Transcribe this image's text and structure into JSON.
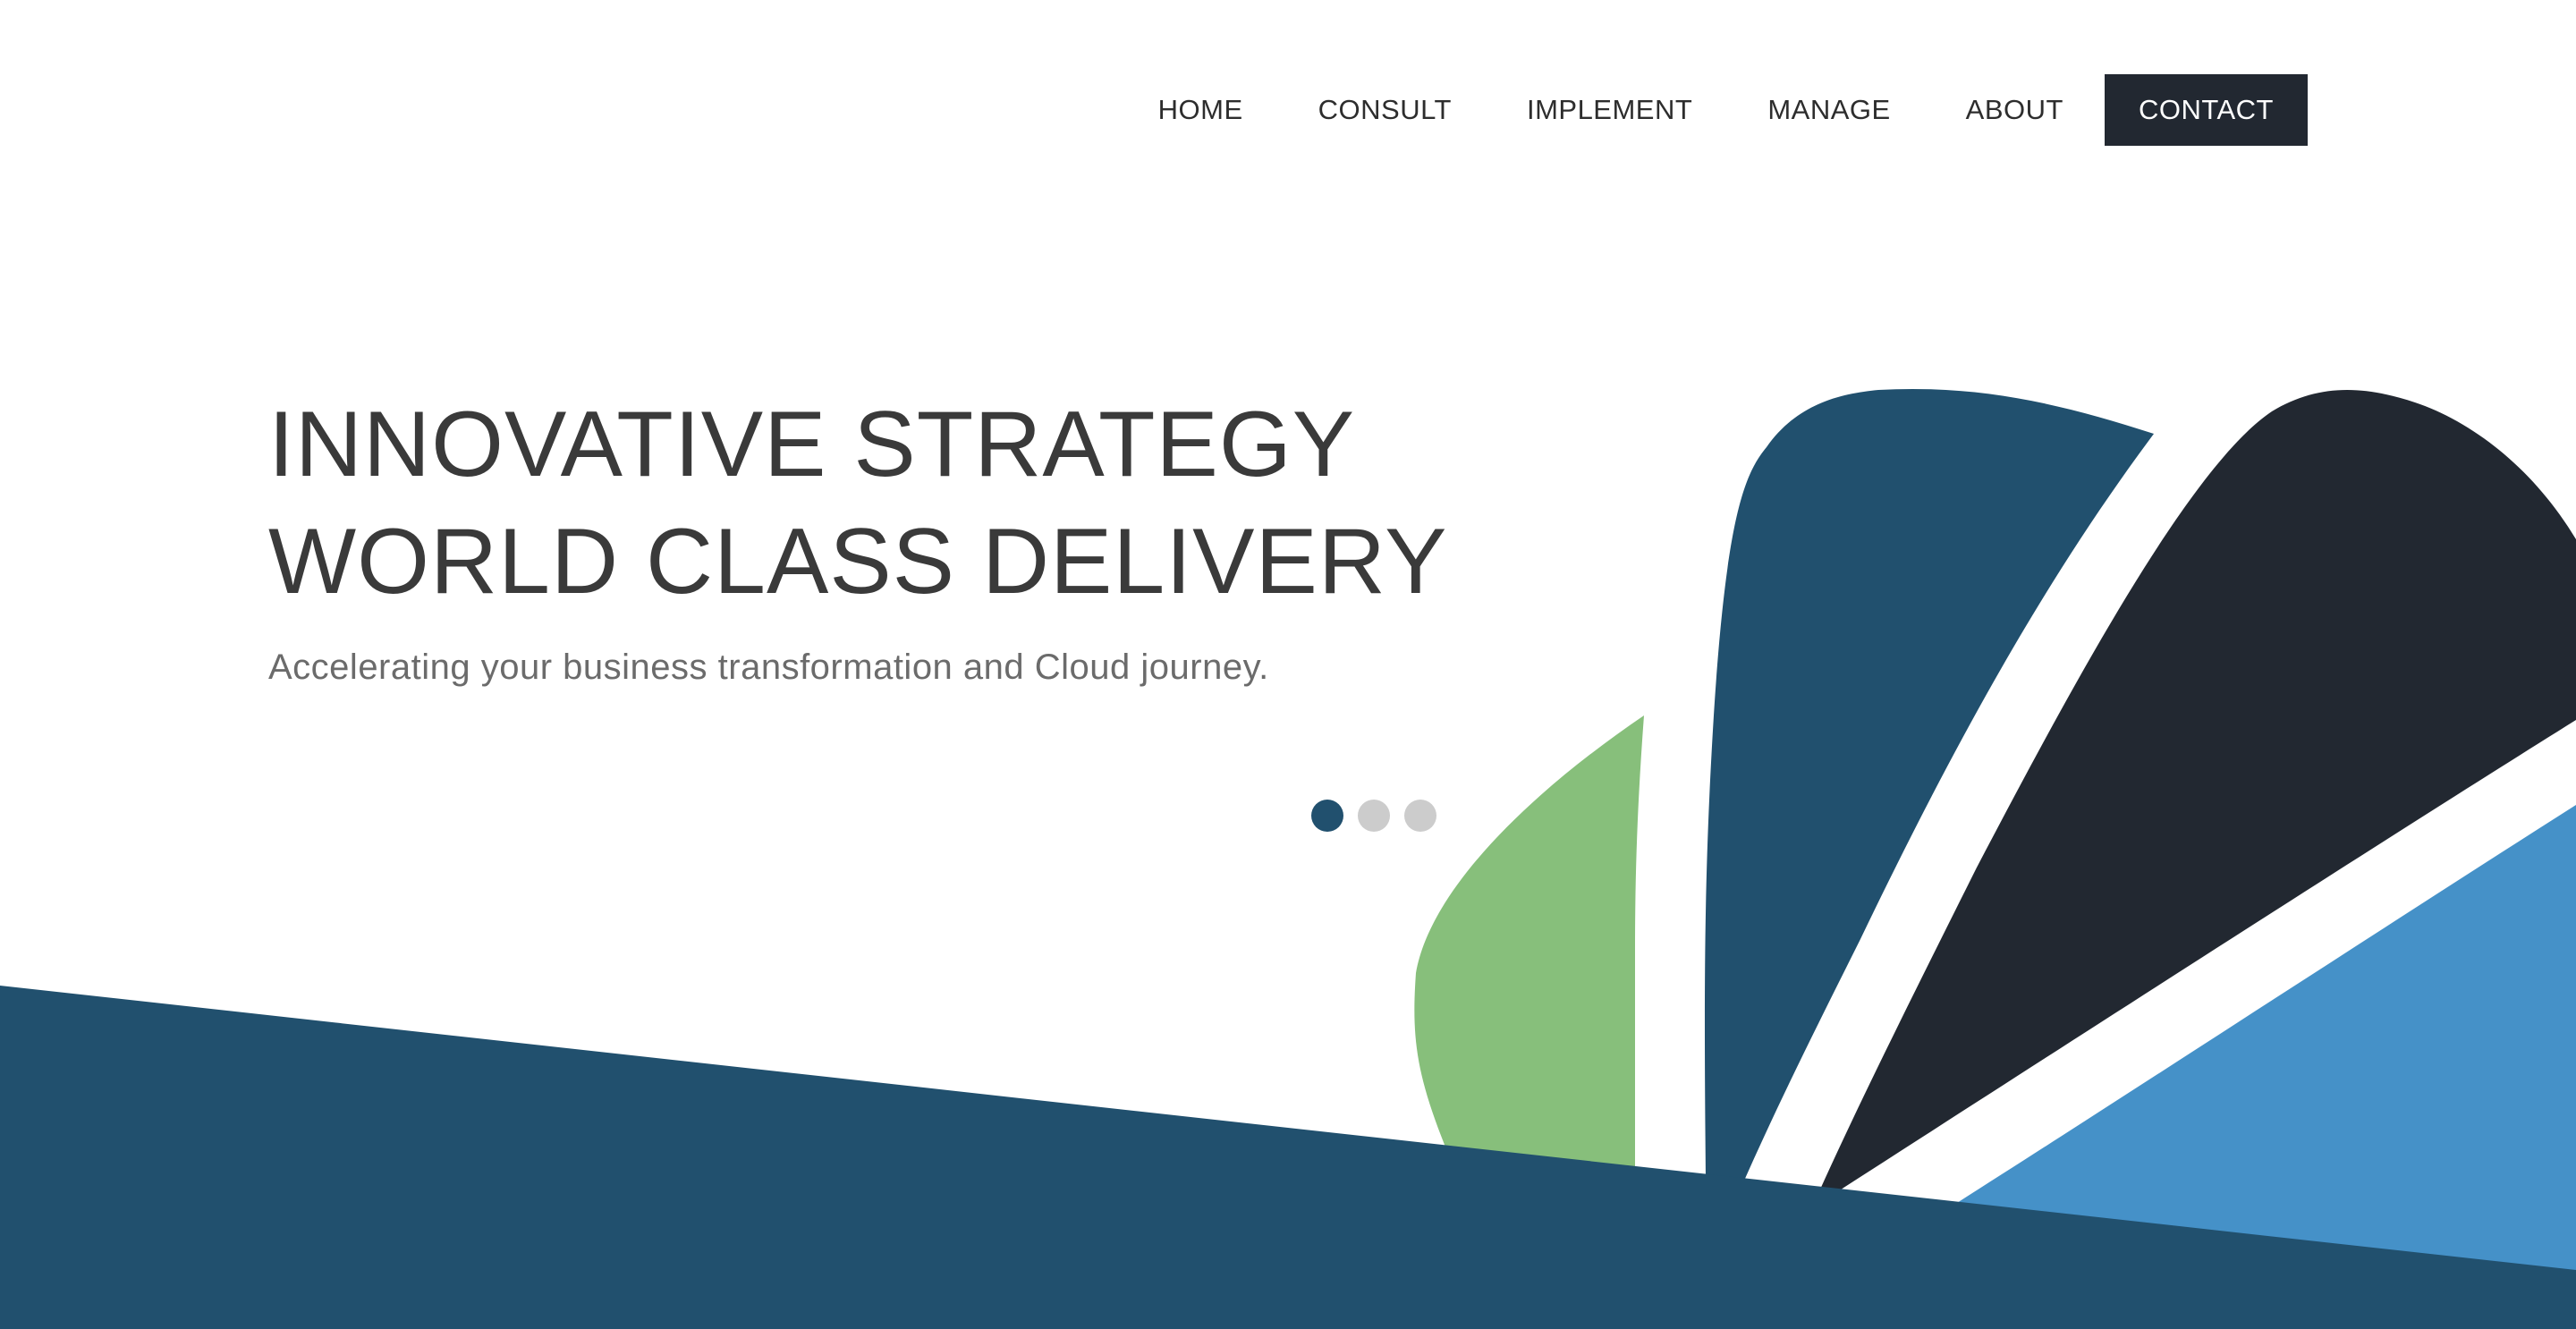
{
  "nav": {
    "items": [
      {
        "label": "HOME"
      },
      {
        "label": "CONSULT"
      },
      {
        "label": "IMPLEMENT"
      },
      {
        "label": "MANAGE"
      },
      {
        "label": "ABOUT"
      }
    ],
    "contact_label": "CONTACT"
  },
  "hero": {
    "title_line1": "INNOVATIVE STRATEGY",
    "title_line2": "WORLD CLASS DELIVERY",
    "subtitle": "Accelerating your business transformation and Cloud journey."
  },
  "slider": {
    "count": 3,
    "active_index": 0
  },
  "colors": {
    "navy": "#21506e",
    "dark": "#222831",
    "green": "#87bf7b",
    "light_blue": "#4591c8",
    "text": "#3a3a3a",
    "dot_inactive": "#cccccc"
  }
}
